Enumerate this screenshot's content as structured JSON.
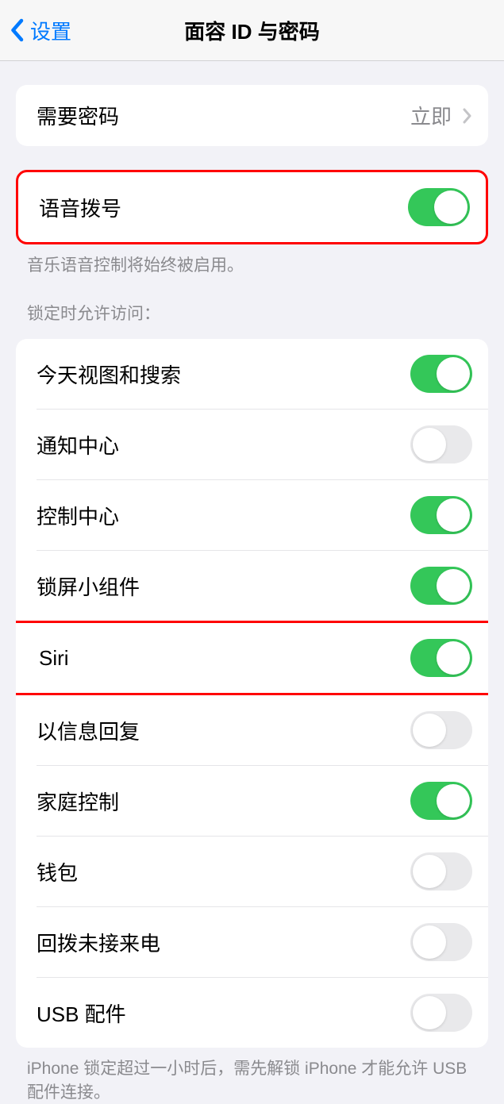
{
  "nav": {
    "back_label": "设置",
    "title": "面容 ID 与密码"
  },
  "passcode_row": {
    "label": "需要密码",
    "value": "立即"
  },
  "voice_dial": {
    "label": "语音拨号",
    "on": true,
    "footer": "音乐语音控制将始终被启用。"
  },
  "lock_access": {
    "header": "锁定时允许访问：",
    "items": [
      {
        "label": "今天视图和搜索",
        "on": true
      },
      {
        "label": "通知中心",
        "on": false
      },
      {
        "label": "控制中心",
        "on": true
      },
      {
        "label": "锁屏小组件",
        "on": true
      },
      {
        "label": "Siri",
        "on": true,
        "highlighted": true
      },
      {
        "label": "以信息回复",
        "on": false
      },
      {
        "label": "家庭控制",
        "on": true
      },
      {
        "label": "钱包",
        "on": false
      },
      {
        "label": "回拨未接来电",
        "on": false
      },
      {
        "label": "USB 配件",
        "on": false
      }
    ],
    "footer": "iPhone 锁定超过一小时后，需先解锁 iPhone 才能允许 USB 配件连接。"
  }
}
